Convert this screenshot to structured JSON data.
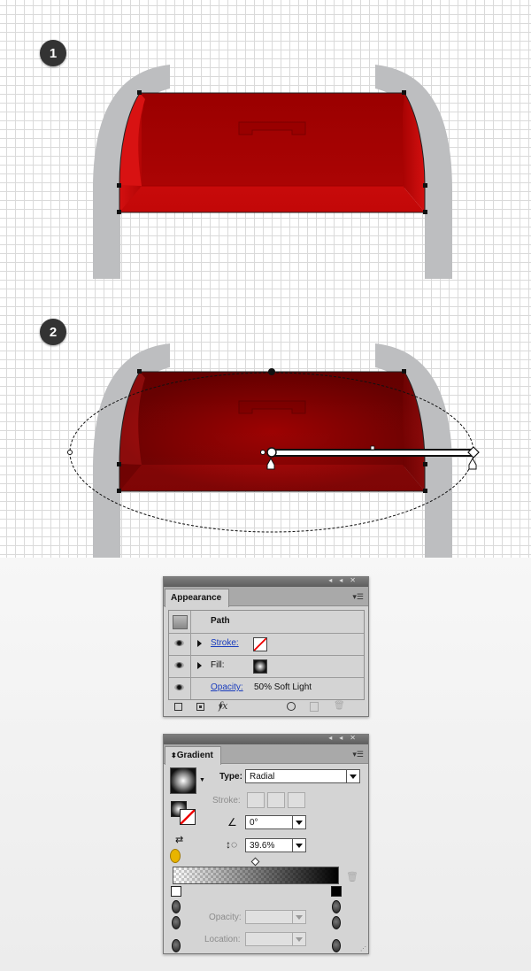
{
  "steps": [
    {
      "number": "1"
    },
    {
      "number": "2"
    }
  ],
  "colors": {
    "shape_red": "#c40c0c",
    "shape_dark_red": "#8c0000",
    "leg_gray": "#bdbec0",
    "panel_bg": "#d4d4d4",
    "link_blue": "#1a3dbd"
  },
  "appearance_panel": {
    "tab_label": "Appearance",
    "object_label": "Path",
    "rows": [
      {
        "label": "Stroke:",
        "is_link": true,
        "has_expand": true,
        "swatch": "none-swatch-icon"
      },
      {
        "label": "Fill:",
        "is_link": false,
        "has_expand": true,
        "swatch": "radial-gradient-swatch-icon"
      },
      {
        "label": "Opacity:",
        "is_link": true,
        "has_expand": false,
        "value": "50% Soft Light"
      }
    ],
    "footer_icons": [
      "add-stroke-icon",
      "add-fill-icon",
      "fx-icon",
      "clear-appearance-icon",
      "duplicate-item-icon",
      "delete-item-icon"
    ],
    "fx_label": "fx"
  },
  "gradient_panel": {
    "tab_label": "Gradient",
    "type_label": "Type:",
    "type_value": "Radial",
    "stroke_label": "Stroke:",
    "angle_value": "0°",
    "aspect_value": "39.6%",
    "opacity_label": "Opacity:",
    "location_label": "Location:"
  }
}
